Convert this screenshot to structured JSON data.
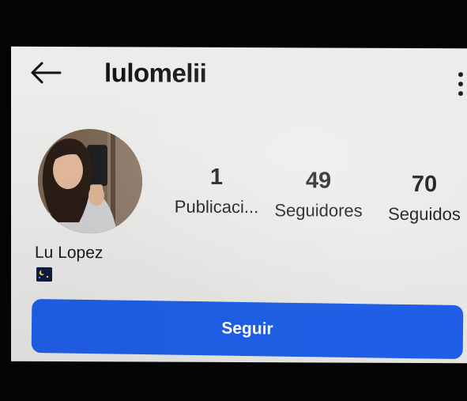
{
  "header": {
    "username": "lulomelii",
    "back_icon": "arrow-left-icon",
    "more_icon": "more-vertical-icon"
  },
  "profile": {
    "avatar": "avatar",
    "display_name": "Lu Lopez",
    "bio_emoji": "night-sky-emoji"
  },
  "stats": {
    "posts": {
      "value": "1",
      "label": "Publicaci..."
    },
    "followers": {
      "value": "49",
      "label": "Seguidores"
    },
    "following": {
      "value": "70",
      "label": "Seguidos"
    }
  },
  "actions": {
    "follow_label": "Seguir"
  },
  "colors": {
    "accent": "#1f5ee6",
    "screen_background": "#ececea",
    "text": "#141414"
  }
}
